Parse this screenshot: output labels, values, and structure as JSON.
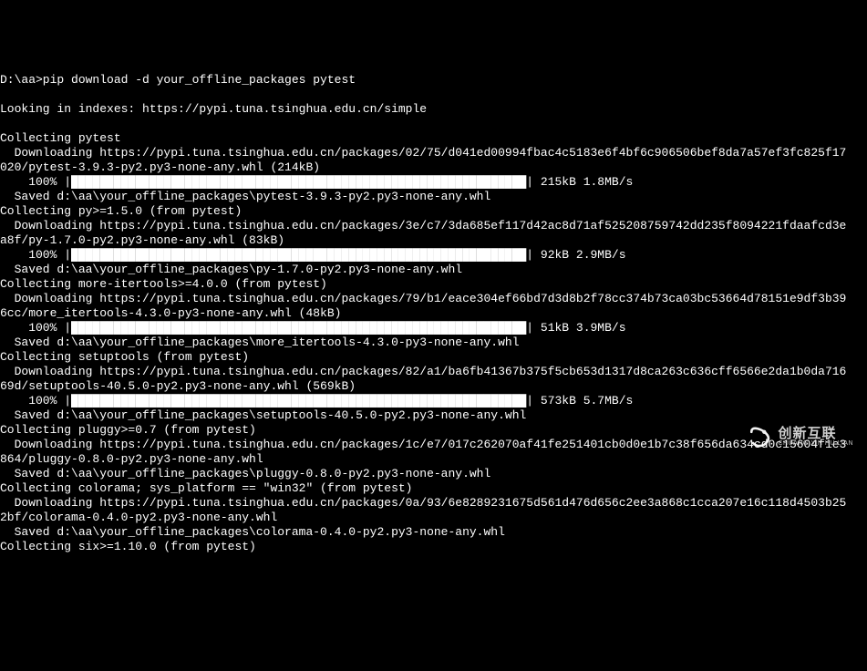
{
  "prompt": "D:\\aa>pip download -d your_offline_packages pytest",
  "index_line": "Looking in indexes: https://pypi.tuna.tsinghua.edu.cn/simple",
  "blocks": [
    {
      "collect": "Collecting pytest",
      "download_lines": [
        "  Downloading https://pypi.tuna.tsinghua.edu.cn/packages/02/75/d041ed00994fbac4c5183e6f4bf6c906506bef8da7a57ef3fc825f17",
        "020/pytest-3.9.3-py2.py3-none-any.whl (214kB)"
      ],
      "progress_pct": "    100% |",
      "progress_bar": "████████████████████████████████████████████████████████████████",
      "progress_suffix": "| 215kB 1.8MB/s",
      "saved": "  Saved d:\\aa\\your_offline_packages\\pytest-3.9.3-py2.py3-none-any.whl"
    },
    {
      "collect": "Collecting py>=1.5.0 (from pytest)",
      "download_lines": [
        "  Downloading https://pypi.tuna.tsinghua.edu.cn/packages/3e/c7/3da685ef117d42ac8d71af525208759742dd235f8094221fdaafcd3e",
        "a8f/py-1.7.0-py2.py3-none-any.whl (83kB)"
      ],
      "progress_pct": "    100% |",
      "progress_bar": "████████████████████████████████████████████████████████████████",
      "progress_suffix": "| 92kB 2.9MB/s",
      "saved": "  Saved d:\\aa\\your_offline_packages\\py-1.7.0-py2.py3-none-any.whl"
    },
    {
      "collect": "Collecting more-itertools>=4.0.0 (from pytest)",
      "download_lines": [
        "  Downloading https://pypi.tuna.tsinghua.edu.cn/packages/79/b1/eace304ef66bd7d3d8b2f78cc374b73ca03bc53664d78151e9df3b39",
        "6cc/more_itertools-4.3.0-py3-none-any.whl (48kB)"
      ],
      "progress_pct": "    100% |",
      "progress_bar": "████████████████████████████████████████████████████████████████",
      "progress_suffix": "| 51kB 3.9MB/s",
      "saved": "  Saved d:\\aa\\your_offline_packages\\more_itertools-4.3.0-py3-none-any.whl"
    },
    {
      "collect": "Collecting setuptools (from pytest)",
      "download_lines": [
        "  Downloading https://pypi.tuna.tsinghua.edu.cn/packages/82/a1/ba6fb41367b375f5cb653d1317d8ca263c636cff6566e2da1b0da716",
        "69d/setuptools-40.5.0-py2.py3-none-any.whl (569kB)"
      ],
      "progress_pct": "    100% |",
      "progress_bar": "████████████████████████████████████████████████████████████████",
      "progress_suffix": "| 573kB 5.7MB/s",
      "saved": "  Saved d:\\aa\\your_offline_packages\\setuptools-40.5.0-py2.py3-none-any.whl"
    },
    {
      "collect": "Collecting pluggy>=0.7 (from pytest)",
      "download_lines": [
        "  Downloading https://pypi.tuna.tsinghua.edu.cn/packages/1c/e7/017c262070af41fe251401cb0d0e1b7c38f656da634cd0c15604f1e3",
        "864/pluggy-0.8.0-py2.py3-none-any.whl"
      ],
      "saved": "  Saved d:\\aa\\your_offline_packages\\pluggy-0.8.0-py2.py3-none-any.whl"
    },
    {
      "collect": "Collecting colorama; sys_platform == \"win32\" (from pytest)",
      "download_lines": [
        "  Downloading https://pypi.tuna.tsinghua.edu.cn/packages/0a/93/6e8289231675d561d476d656c2ee3a868c1cca207e16c118d4503b25",
        "2bf/colorama-0.4.0-py2.py3-none-any.whl"
      ],
      "saved": "  Saved d:\\aa\\your_offline_packages\\colorama-0.4.0-py2.py3-none-any.whl"
    },
    {
      "collect": "Collecting six>=1.10.0 (from pytest)",
      "download_lines": [],
      "saved": ""
    }
  ],
  "watermark": {
    "cn": "创新互联",
    "en": "CHUANG XIN HU LIAN"
  }
}
